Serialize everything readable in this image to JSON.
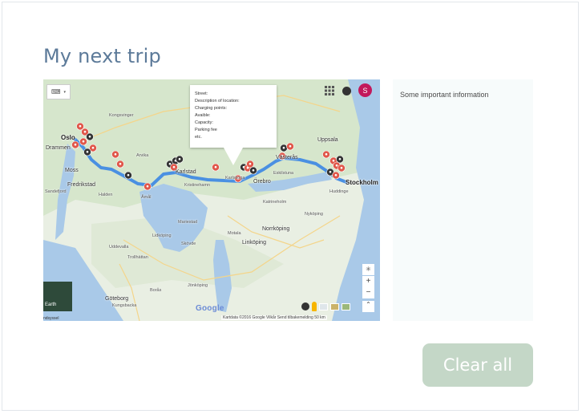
{
  "page": {
    "title": "My next trip"
  },
  "map": {
    "keyboard_label": "⌨",
    "avatar_initial": "S",
    "popup": {
      "lines": [
        "Street:",
        "Description of location:",
        "Charging points:",
        "Avaible:",
        "Capacity:",
        "Parking fee",
        "etc."
      ]
    },
    "cities": {
      "oslo": "Oslo",
      "drammen": "Drammen",
      "moss": "Moss",
      "fredrikstad": "Fredrikstad",
      "sandefjord": "Sandefjord",
      "halden": "Halden",
      "kongsvinger": "Kongsvinger",
      "arvika": "Arvika",
      "karlstad": "Karlstad",
      "kristinehamn": "Kristinehamn",
      "amal": "Åmål",
      "karlskoga": "Karlskoga",
      "orebro": "Örebro",
      "vasteras": "Västerås",
      "eskilstuna": "Eskilstuna",
      "uppsala": "Uppsala",
      "stockholm": "Stockholm",
      "huddinge": "Huddinge",
      "katrineholm": "Katrineholm",
      "motala": "Motala",
      "linkoping": "Linköping",
      "norrkoping": "Norrköping",
      "nykoping": "Nyköping",
      "mariestad": "Mariestad",
      "lidkoping": "Lidköping",
      "skovde": "Skövde",
      "uddevalla": "Uddevalla",
      "trollhattan": "Trollhättan",
      "goteborg": "Göteborg",
      "boras": "Borås",
      "jonkoping": "Jönköping",
      "kungsbacka": "Kungsbacka"
    },
    "google_logo": "Google",
    "attribution": "Kartdata ©2016 Google   Vilkår   Send tilbakemelding   50 km",
    "earth_label": "Earth",
    "footer_label": "ndsyssel",
    "zoom_in": "+",
    "zoom_out": "−",
    "route_color": "#4a90e2",
    "marker_color": "#e0574a",
    "marker_dark_color": "#333333"
  },
  "info": {
    "text": "Some important information"
  },
  "actions": {
    "clear_label": "Clear all"
  },
  "colors": {
    "title": "#5c7a99",
    "button": "#c4d7c7",
    "panel": "#f7fbfb"
  }
}
